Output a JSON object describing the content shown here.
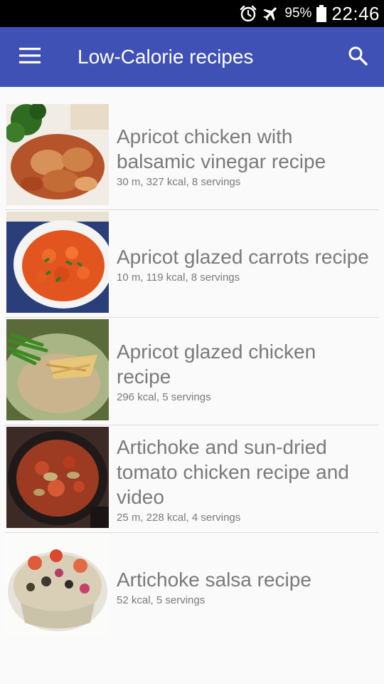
{
  "status_bar": {
    "battery_percent": "95%",
    "time": "22:46",
    "icons": [
      "alarm-clock-icon",
      "airplane-mode-icon",
      "battery-icon"
    ]
  },
  "app_bar": {
    "title": "Low-Calorie recipes",
    "menu_icon": "hamburger-menu-icon",
    "search_icon": "search-icon",
    "color": "#3f51b5"
  },
  "recipes": [
    {
      "title": "Apricot chicken with balsamic vinegar recipe",
      "meta": "30 m, 327 kcal, 8 servings"
    },
    {
      "title": "Apricot glazed carrots recipe",
      "meta": "10 m, 119 kcal, 8 servings"
    },
    {
      "title": "Apricot glazed chicken recipe",
      "meta": "296 kcal, 5 servings"
    },
    {
      "title": "Artichoke and sun-dried tomato chicken recipe and video",
      "meta": "25 m, 228 kcal, 4 servings"
    },
    {
      "title": "Artichoke salsa recipe",
      "meta": "52 kcal, 5 servings"
    }
  ]
}
